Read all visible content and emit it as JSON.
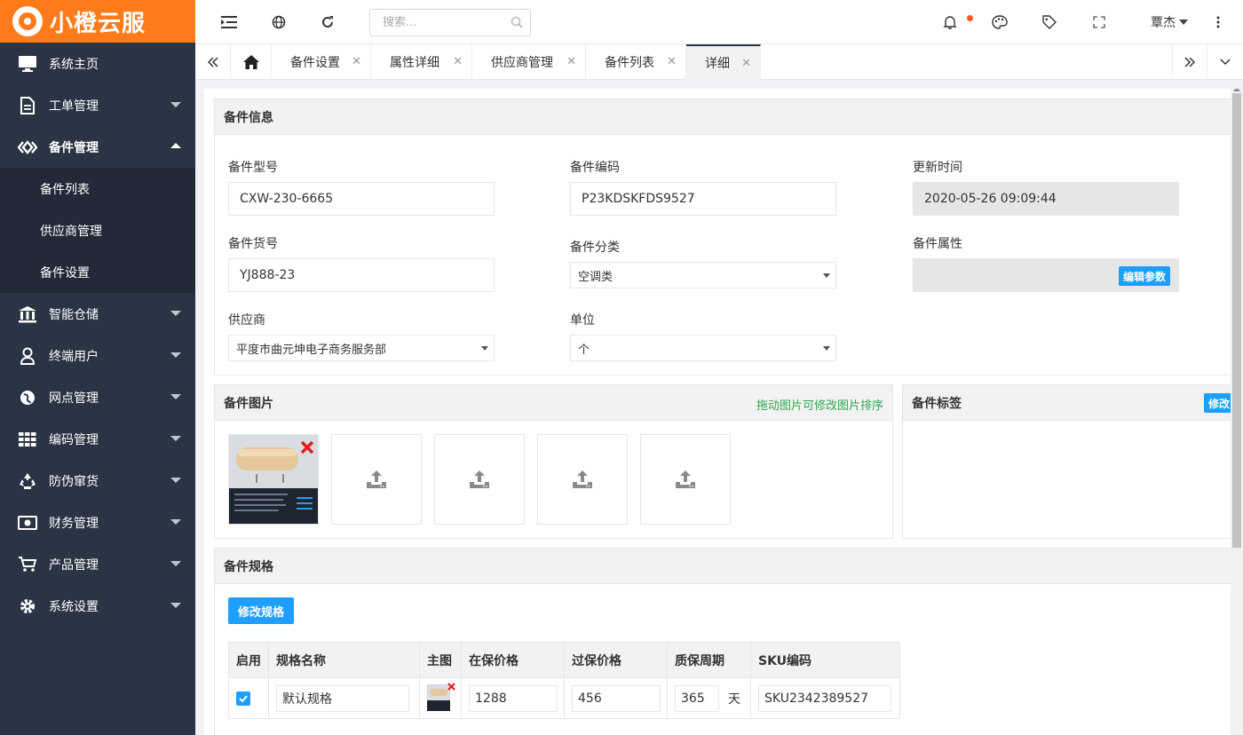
{
  "app": {
    "brand": "小橙云服",
    "brand_color": "#ff7b1a",
    "sidebar_bg": "#2b3445",
    "accent": "#1e9fff"
  },
  "sidebar": {
    "items": [
      {
        "label": "系统主页",
        "icon": "monitor-icon"
      },
      {
        "label": "工单管理",
        "icon": "document-icon"
      },
      {
        "label": "备件管理",
        "icon": "diamond-nodes-icon",
        "expanded": true,
        "children": [
          {
            "label": "备件列表"
          },
          {
            "label": "供应商管理"
          },
          {
            "label": "备件设置"
          }
        ]
      },
      {
        "label": "智能仓储",
        "icon": "bank-icon"
      },
      {
        "label": "终端用户",
        "icon": "user-icon"
      },
      {
        "label": "网点管理",
        "icon": "globe-icon"
      },
      {
        "label": "编码管理",
        "icon": "grid-icon"
      },
      {
        "label": "防伪窜货",
        "icon": "recycle-icon"
      },
      {
        "label": "财务管理",
        "icon": "money-icon"
      },
      {
        "label": "产品管理",
        "icon": "cart-icon"
      },
      {
        "label": "系统设置",
        "icon": "gear-icon"
      }
    ]
  },
  "topbar": {
    "search_placeholder": "搜索...",
    "user_name": "覃杰",
    "icons": [
      "menu-fold-icon",
      "globe-icon",
      "refresh-icon",
      "search-icon",
      "bell-icon",
      "palette-icon",
      "tag-icon",
      "fullscreen-icon",
      "more-vertical-icon"
    ]
  },
  "tabs": [
    {
      "label": "备件设置"
    },
    {
      "label": "属性详细"
    },
    {
      "label": "供应商管理"
    },
    {
      "label": "备件列表"
    },
    {
      "label": "详细",
      "active": true
    }
  ],
  "info": {
    "title": "备件信息",
    "model_label": "备件型号",
    "model_value": "CXW-230-6665",
    "code_label": "备件编码",
    "code_value": "P23KDSKFDS9527",
    "updated_label": "更新时间",
    "updated_value": "2020-05-26 09:09:44",
    "item_no_label": "备件货号",
    "item_no_value": "YJ888-23",
    "category_label": "备件分类",
    "category_value": "空调类",
    "attr_label": "备件属性",
    "edit_params": "编辑参数",
    "supplier_label": "供应商",
    "supplier_value": "平度市曲元坤电子商务服务部",
    "unit_label": "单位",
    "unit_value": "个"
  },
  "images": {
    "title": "备件图片",
    "hint": "拖动图片可修改图片排序",
    "upload_slots": 4
  },
  "tags": {
    "title": "备件标签",
    "edit": "修改"
  },
  "spec": {
    "title": "备件规格",
    "edit_button": "修改规格",
    "columns": [
      "启用",
      "规格名称",
      "主图",
      "在保价格",
      "过保价格",
      "质保周期",
      "SKU编码"
    ],
    "rows": [
      {
        "enabled": true,
        "name": "默认规格",
        "in_warranty": "1288",
        "out_warranty": "456",
        "period": "365",
        "period_unit": "天",
        "sku": "SKU2342389527"
      }
    ]
  }
}
